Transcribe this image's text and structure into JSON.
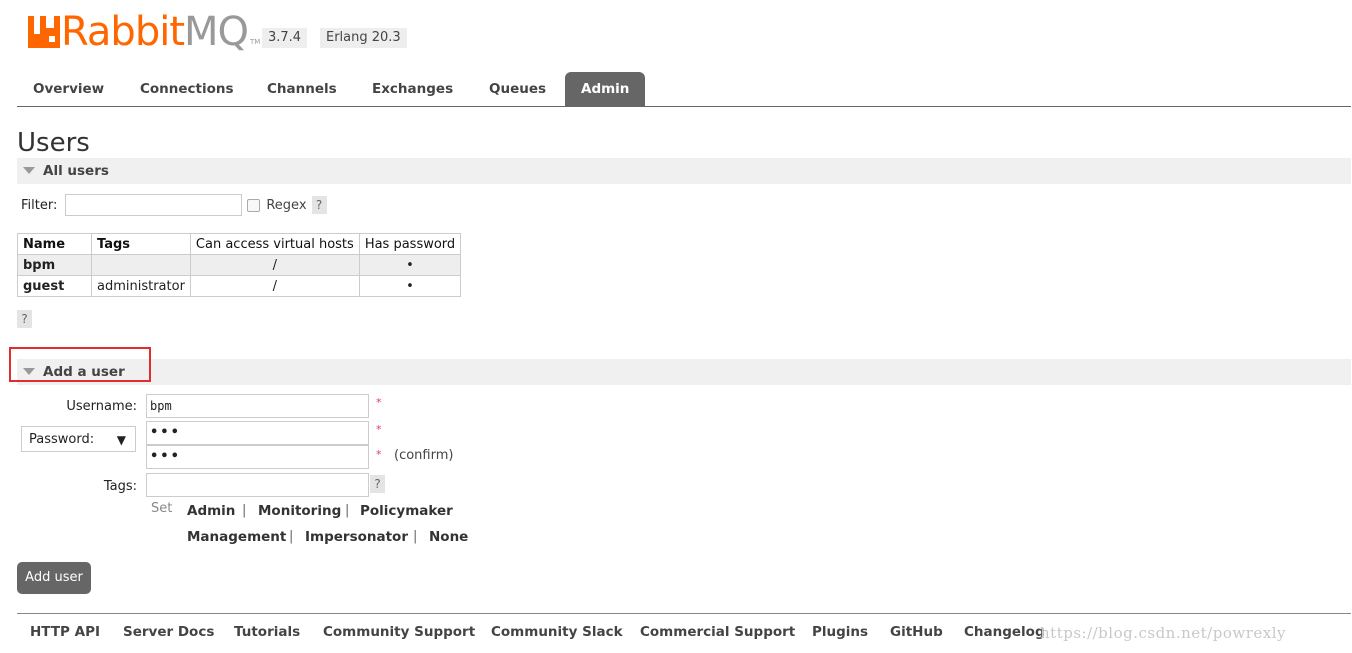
{
  "logo": {
    "rabbit": "Rabbit",
    "mq": "MQ",
    "tm": "TM"
  },
  "versions": {
    "rabbitmq": "3.7.4",
    "erlang": "Erlang 20.3"
  },
  "tabs": [
    {
      "label": "Overview"
    },
    {
      "label": "Connections"
    },
    {
      "label": "Channels"
    },
    {
      "label": "Exchanges"
    },
    {
      "label": "Queues"
    },
    {
      "label": "Admin",
      "active": true
    }
  ],
  "page_title": "Users",
  "all_users": {
    "heading": "All users",
    "filter_label": "Filter:",
    "filter_value": "",
    "regex_label": "Regex",
    "help": "?",
    "columns": [
      "Name",
      "Tags",
      "Can access virtual hosts",
      "Has password"
    ],
    "rows": [
      {
        "name": "bpm",
        "tags": "",
        "vhosts": "/",
        "has_password": "•"
      },
      {
        "name": "guest",
        "tags": "administrator",
        "vhosts": "/",
        "has_password": "•"
      }
    ]
  },
  "add_user": {
    "heading": "Add a user",
    "username_label": "Username:",
    "username_value": "bpm",
    "password_select": "Password:",
    "password_dots": "•••",
    "confirm_dots": "•••",
    "required_mark": "*",
    "confirm_label": "(confirm)",
    "tags_label": "Tags:",
    "tags_value": "",
    "set_label": "Set",
    "tag_options": [
      "Admin",
      "Monitoring",
      "Policymaker",
      "Management",
      "Impersonator",
      "None"
    ],
    "separator": "|",
    "submit_label": "Add user"
  },
  "footer": {
    "links": [
      "HTTP API",
      "Server Docs",
      "Tutorials",
      "Community Support",
      "Community Slack",
      "Commercial Support",
      "Plugins",
      "GitHub",
      "Changelog"
    ],
    "watermark": "https://blog.csdn.net/powrexly"
  },
  "colors": {
    "brand": "#ff6600",
    "tab_active": "#666666",
    "highlight_box": "#e12d2d"
  }
}
